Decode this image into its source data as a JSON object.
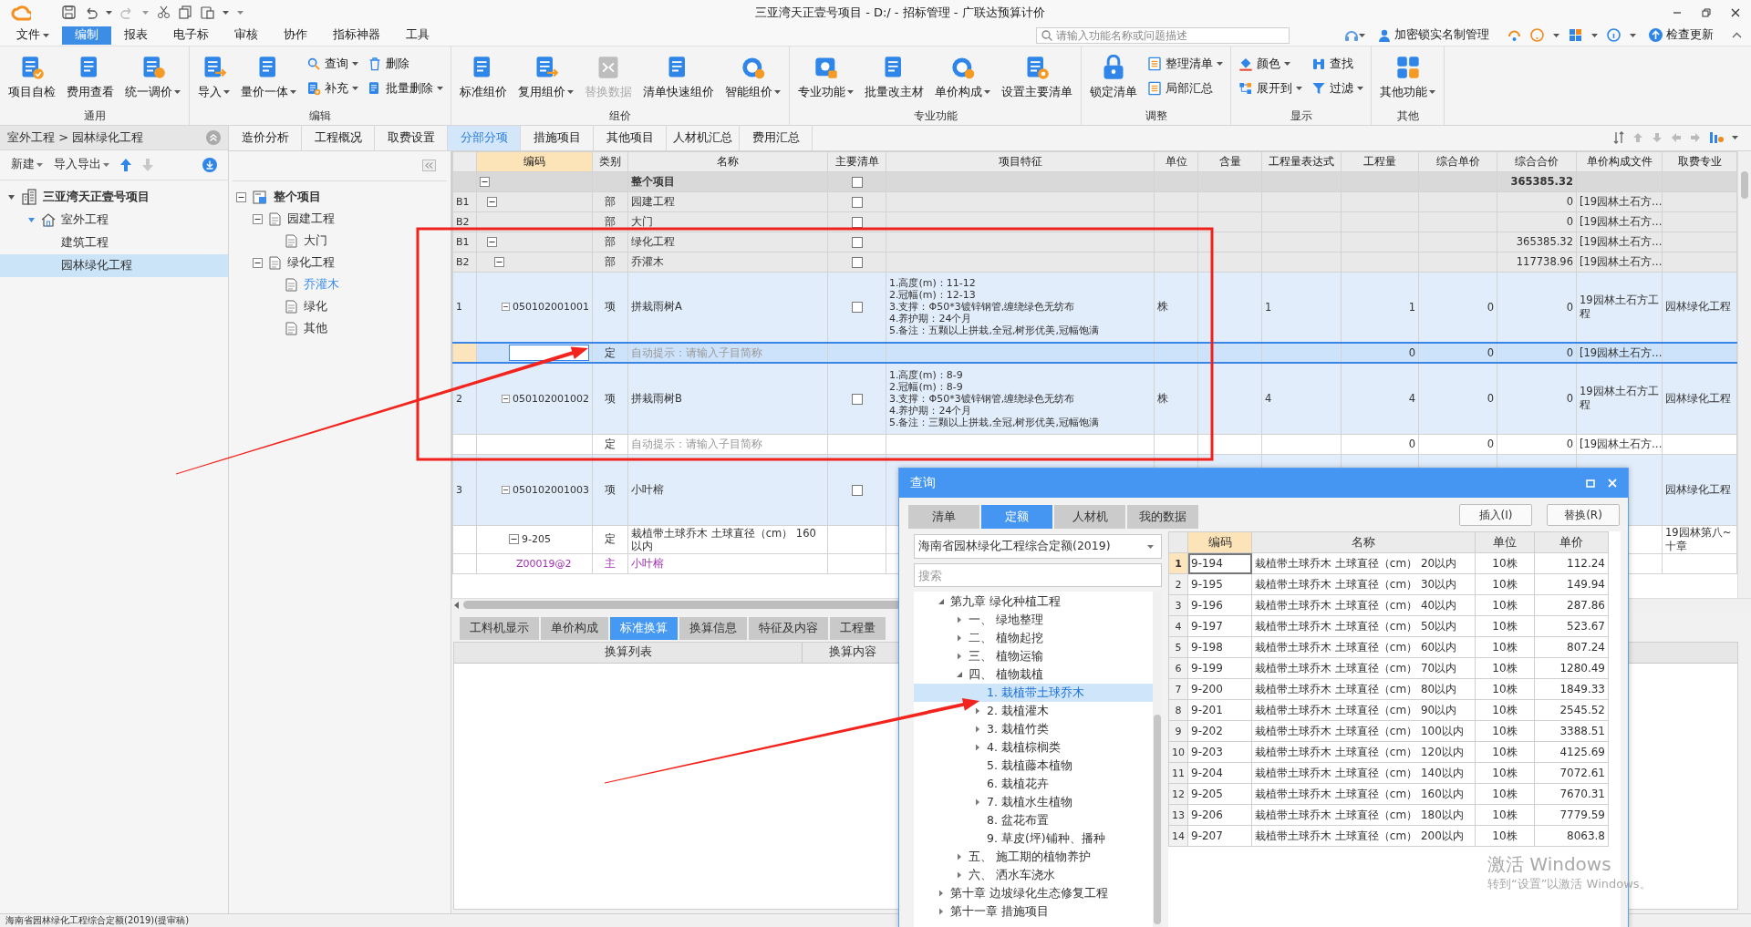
{
  "window": {
    "title": "三亚湾天正壹号项目 - D:/ - 招标管理 - 广联达预算计价"
  },
  "menu": [
    {
      "label": "文件",
      "dropdown": true,
      "selected": false
    },
    {
      "label": "编制",
      "dropdown": false,
      "selected": true
    },
    {
      "label": "报表",
      "dropdown": false,
      "selected": false
    },
    {
      "label": "电子标",
      "dropdown": false,
      "selected": false
    },
    {
      "label": "审核",
      "dropdown": false,
      "selected": false
    },
    {
      "label": "协作",
      "dropdown": false,
      "selected": false
    },
    {
      "label": "指标神器",
      "dropdown": false,
      "selected": false
    },
    {
      "label": "工具",
      "dropdown": false,
      "selected": false
    }
  ],
  "search": {
    "placeholder": "请输入功能名称或问题描述"
  },
  "account_links": [
    {
      "label": "加密锁实名制管理"
    },
    {
      "label": "检查更新"
    }
  ],
  "ribbon": [
    {
      "title": "通用",
      "items": [
        {
          "label": "项目自检",
          "kind": "large",
          "dropdown": false,
          "disabled": false
        },
        {
          "label": "费用查看",
          "kind": "large",
          "dropdown": false,
          "disabled": false
        },
        {
          "label": "统一调价",
          "kind": "large",
          "dropdown": true,
          "disabled": false
        }
      ]
    },
    {
      "title": "编辑",
      "items": [
        {
          "label": "导入",
          "kind": "large",
          "dropdown": true,
          "disabled": false
        },
        {
          "label": "量价一体",
          "kind": "large",
          "dropdown": true,
          "disabled": false
        },
        {
          "label": "查询",
          "kind": "small",
          "dropdown": true,
          "disabled": false
        },
        {
          "label": "补充",
          "kind": "small",
          "dropdown": true,
          "disabled": false
        },
        {
          "label": "删除",
          "kind": "small",
          "dropdown": false,
          "disabled": false
        },
        {
          "label": "批量删除",
          "kind": "small",
          "dropdown": true,
          "disabled": false
        }
      ]
    },
    {
      "title": "组价",
      "items": [
        {
          "label": "标准组价",
          "kind": "large",
          "dropdown": false,
          "disabled": false
        },
        {
          "label": "复用组价",
          "kind": "large",
          "dropdown": true,
          "disabled": false
        },
        {
          "label": "替换数据",
          "kind": "large",
          "dropdown": false,
          "disabled": true
        },
        {
          "label": "清单快速组价",
          "kind": "large",
          "dropdown": false,
          "disabled": false
        },
        {
          "label": "智能组价",
          "kind": "large",
          "dropdown": true,
          "disabled": false
        }
      ]
    },
    {
      "title": "专业功能",
      "items": [
        {
          "label": "专业功能",
          "kind": "large",
          "dropdown": true,
          "disabled": false
        },
        {
          "label": "批量改主材",
          "kind": "large",
          "dropdown": false,
          "disabled": false
        },
        {
          "label": "单价构成",
          "kind": "large",
          "dropdown": true,
          "disabled": false
        },
        {
          "label": "设置主要清单",
          "kind": "large",
          "dropdown": false,
          "disabled": false
        }
      ]
    },
    {
      "title": "调整",
      "items": [
        {
          "label": "锁定清单",
          "kind": "large",
          "dropdown": false,
          "disabled": false
        },
        {
          "label": "整理清单",
          "kind": "small",
          "dropdown": true,
          "disabled": false
        },
        {
          "label": "局部汇总",
          "kind": "small",
          "dropdown": false,
          "disabled": false
        }
      ]
    },
    {
      "title": "显示",
      "items": [
        {
          "label": "颜色",
          "kind": "small",
          "dropdown": true,
          "disabled": false
        },
        {
          "label": "展开到",
          "kind": "small",
          "dropdown": true,
          "disabled": false
        },
        {
          "label": "查找",
          "kind": "small",
          "dropdown": false,
          "disabled": false
        },
        {
          "label": "过滤",
          "kind": "small",
          "dropdown": true,
          "disabled": false
        }
      ]
    },
    {
      "title": "其他",
      "items": [
        {
          "label": "其他功能",
          "kind": "large",
          "dropdown": true,
          "disabled": false
        }
      ]
    }
  ],
  "nav_panel": {
    "breadcrumb": "室外工程 > 园林绿化工程",
    "actions": [
      {
        "label": "新建"
      },
      {
        "label": "导入导出"
      }
    ],
    "tree": [
      {
        "label": "三亚湾天正壹号项目",
        "selected": false,
        "expanded": true,
        "children": [
          {
            "label": "室外工程",
            "selected": false,
            "expanded": true,
            "children": [
              {
                "label": "建筑工程",
                "selected": false
              },
              {
                "label": "园林绿化工程",
                "selected": true
              }
            ]
          }
        ]
      }
    ]
  },
  "view_tabs": [
    {
      "label": "造价分析",
      "selected": false
    },
    {
      "label": "工程概况",
      "selected": false
    },
    {
      "label": "取费设置",
      "selected": false
    },
    {
      "label": "分部分项",
      "selected": true
    },
    {
      "label": "措施项目",
      "selected": false
    },
    {
      "label": "其他项目",
      "selected": false
    },
    {
      "label": "人材机汇总",
      "selected": false
    },
    {
      "label": "费用汇总",
      "selected": false
    }
  ],
  "section_tree": [
    {
      "label": "整个项目",
      "selected": false,
      "expanded": true,
      "children": [
        {
          "label": "园建工程",
          "selected": false,
          "expanded": true,
          "children": [
            {
              "label": "大门",
              "selected": false
            }
          ]
        },
        {
          "label": "绿化工程",
          "selected": false,
          "expanded": true,
          "children": [
            {
              "label": "乔灌木",
              "selected": true
            },
            {
              "label": "绿化",
              "selected": false
            },
            {
              "label": "其他",
              "selected": false
            }
          ]
        }
      ]
    }
  ],
  "bill_table": {
    "columns": [
      {
        "label": "编码",
        "selected": true
      },
      {
        "label": "类别",
        "selected": false
      },
      {
        "label": "名称",
        "selected": false
      },
      {
        "label": "主要清单",
        "selected": false
      },
      {
        "label": "项目特征",
        "selected": false
      },
      {
        "label": "单位",
        "selected": false
      },
      {
        "label": "含量",
        "selected": false
      },
      {
        "label": "工程量表达式",
        "selected": false
      },
      {
        "label": "工程量",
        "selected": false
      },
      {
        "label": "综合单价",
        "selected": false
      },
      {
        "label": "综合合价",
        "selected": false
      },
      {
        "label": "单价构成文件",
        "selected": false
      },
      {
        "label": "取费专业",
        "selected": false
      }
    ],
    "rows": [
      {
        "kind": "root",
        "selected": false,
        "expanded": true,
        "name": "整个项目",
        "checked": false,
        "total": "365385.32",
        "children": [
          {
            "kind": "section",
            "num": "B1",
            "selected": false,
            "expanded": true,
            "type": "部",
            "name": "园建工程",
            "checked": false,
            "total": "0",
            "price_file": "[19园林土石方…",
            "children": [
              {
                "kind": "section",
                "num": "B2",
                "selected": false,
                "type": "部",
                "name": "大门",
                "checked": false,
                "total": "0",
                "price_file": "[19园林土石方…"
              }
            ]
          },
          {
            "kind": "section",
            "num": "B1",
            "selected": false,
            "expanded": true,
            "type": "部",
            "name": "绿化工程",
            "checked": false,
            "total": "365385.32",
            "price_file": "[19园林土石方…",
            "children": [
              {
                "kind": "section",
                "num": "B2",
                "selected": false,
                "expanded": true,
                "type": "部",
                "name": "乔灌木",
                "checked": false,
                "total": "117738.96",
                "price_file": "[19园林土石方…",
                "children": [
                  {
                    "kind": "item",
                    "num": "1",
                    "selected": false,
                    "expanded": true,
                    "code": "050102001001",
                    "type": "项",
                    "name": "拼栽雨树A",
                    "checked": false,
                    "features": [
                      "1.高度(m)：11-12",
                      "2.冠幅(m)：12-13",
                      "3.支撑：Φ50*3镀锌钢管,缠绕绿色无纺布",
                      "4.养护期：24个月",
                      "5.备注：五颗以上拼栽,全冠,树形优美,冠幅饱满"
                    ],
                    "unit": "株",
                    "quantity_expr": "1",
                    "quantity": "1",
                    "unit_price": "0",
                    "total": "0",
                    "price_file": "19园林土石方工程",
                    "fee_type": "园林绿化工程",
                    "children": [
                      {
                        "kind": "quota",
                        "selected": true,
                        "type": "定",
                        "name_hint": "自动提示：请输入子目简称",
                        "quantity": "0",
                        "unit_price": "0",
                        "total": "0",
                        "price_file": "[19园林土石方…"
                      }
                    ]
                  },
                  {
                    "kind": "item",
                    "num": "2",
                    "selected": false,
                    "expanded": true,
                    "code": "050102001002",
                    "type": "项",
                    "name": "拼栽雨树B",
                    "checked": false,
                    "features": [
                      "1.高度(m)：8-9",
                      "2.冠幅(m)：8-9",
                      "3.支撑：Φ50*3镀锌钢管,缠绕绿色无纺布",
                      "4.养护期：24个月",
                      "5.备注：三颗以上拼栽,全冠,树形优美,冠幅饱满"
                    ],
                    "unit": "株",
                    "quantity_expr": "4",
                    "quantity": "4",
                    "unit_price": "0",
                    "total": "0",
                    "price_file": "19园林土石方工程",
                    "fee_type": "园林绿化工程",
                    "children": [
                      {
                        "kind": "quota",
                        "selected": false,
                        "type": "定",
                        "name_hint": "自动提示：请输入子目简称",
                        "quantity": "0",
                        "unit_price": "0",
                        "total": "0",
                        "price_file": "[19园林土石方…"
                      }
                    ]
                  },
                  {
                    "kind": "item",
                    "num": "3",
                    "selected": false,
                    "expanded": true,
                    "code": "050102001003",
                    "type": "项",
                    "name": "小叶榕",
                    "checked": false,
                    "fee_type": "园林绿化工程",
                    "children": [
                      {
                        "kind": "quota",
                        "selected": false,
                        "expanded": true,
                        "code": "9-205",
                        "type": "定",
                        "name": "栽植带土球乔木 土球直径（cm） 160以内",
                        "fee_type": "19园林第八~十章",
                        "children": [
                          {
                            "kind": "material",
                            "selected": false,
                            "code": "Z00019@2",
                            "type": "主",
                            "name": "小叶榕"
                          }
                        ]
                      }
                    ]
                  }
                ]
              }
            ]
          }
        ]
      }
    ]
  },
  "detail_tabs": [
    {
      "label": "工料机显示",
      "selected": false
    },
    {
      "label": "单价构成",
      "selected": false
    },
    {
      "label": "标准换算",
      "selected": true
    },
    {
      "label": "换算信息",
      "selected": false
    },
    {
      "label": "特征及内容",
      "selected": false
    },
    {
      "label": "工程量",
      "selected": false
    }
  ],
  "detail_columns": [
    "换算列表",
    "换算内容"
  ],
  "query_dialog": {
    "title": "查询",
    "tabs": [
      {
        "label": "清单",
        "selected": false
      },
      {
        "label": "定额",
        "selected": true
      },
      {
        "label": "人材机",
        "selected": false
      },
      {
        "label": "我的数据",
        "selected": false
      }
    ],
    "buttons": [
      {
        "label": "插入(I)"
      },
      {
        "label": "替换(R)"
      }
    ],
    "library": "海南省园林绿化工程综合定额(2019)",
    "search_placeholder": "搜索",
    "tree": [
      {
        "label": "第九章 绿化种植工程",
        "selected": false,
        "expanded": true,
        "children": [
          {
            "label": "一、 绿地整理",
            "selected": false,
            "expanded": false
          },
          {
            "label": "二、 植物起挖",
            "selected": false,
            "expanded": false
          },
          {
            "label": "三、 植物运输",
            "selected": false,
            "expanded": false
          },
          {
            "label": "四、 植物栽植",
            "selected": false,
            "expanded": true,
            "children": [
              {
                "label": "1. 栽植带土球乔木",
                "selected": true
              },
              {
                "label": "2. 栽植灌木",
                "selected": false,
                "expanded": false
              },
              {
                "label": "3. 栽植竹类",
                "selected": false,
                "expanded": false
              },
              {
                "label": "4. 栽植棕榈类",
                "selected": false,
                "expanded": false
              },
              {
                "label": "5. 栽植藤本植物",
                "selected": false
              },
              {
                "label": "6. 栽植花卉",
                "selected": false
              },
              {
                "label": "7. 栽植水生植物",
                "selected": false,
                "expanded": false
              },
              {
                "label": "8. 盆花布置",
                "selected": false
              },
              {
                "label": "9. 草皮(坪)铺种、播种",
                "selected": false
              }
            ]
          },
          {
            "label": "五、 施工期的植物养护",
            "selected": false,
            "expanded": false
          },
          {
            "label": "六、 洒水车浇水",
            "selected": false,
            "expanded": false
          }
        ]
      },
      {
        "label": "第十章 边坡绿化生态修复工程",
        "selected": false,
        "expanded": false
      },
      {
        "label": "第十一章 措施项目",
        "selected": false,
        "expanded": false
      }
    ],
    "columns": [
      {
        "label": "编码",
        "selected": true
      },
      {
        "label": "名称",
        "selected": false
      },
      {
        "label": "单位",
        "selected": false
      },
      {
        "label": "单价",
        "selected": false
      }
    ],
    "rows": [
      {
        "num": "1",
        "code": "9-194",
        "name": "栽植带土球乔木 土球直径（cm） 20以内",
        "unit": "10株",
        "price": "112.24",
        "selected": true
      },
      {
        "num": "2",
        "code": "9-195",
        "name": "栽植带土球乔木 土球直径（cm） 30以内",
        "unit": "10株",
        "price": "149.94",
        "selected": false
      },
      {
        "num": "3",
        "code": "9-196",
        "name": "栽植带土球乔木 土球直径（cm） 40以内",
        "unit": "10株",
        "price": "287.86",
        "selected": false
      },
      {
        "num": "4",
        "code": "9-197",
        "name": "栽植带土球乔木 土球直径（cm） 50以内",
        "unit": "10株",
        "price": "523.67",
        "selected": false
      },
      {
        "num": "5",
        "code": "9-198",
        "name": "栽植带土球乔木 土球直径（cm） 60以内",
        "unit": "10株",
        "price": "807.24",
        "selected": false
      },
      {
        "num": "6",
        "code": "9-199",
        "name": "栽植带土球乔木 土球直径（cm） 70以内",
        "unit": "10株",
        "price": "1280.49",
        "selected": false
      },
      {
        "num": "7",
        "code": "9-200",
        "name": "栽植带土球乔木 土球直径（cm） 80以内",
        "unit": "10株",
        "price": "1849.33",
        "selected": false
      },
      {
        "num": "8",
        "code": "9-201",
        "name": "栽植带土球乔木 土球直径（cm） 90以内",
        "unit": "10株",
        "price": "2545.52",
        "selected": false
      },
      {
        "num": "9",
        "code": "9-202",
        "name": "栽植带土球乔木 土球直径（cm） 100以内",
        "unit": "10株",
        "price": "3388.51",
        "selected": false
      },
      {
        "num": "10",
        "code": "9-203",
        "name": "栽植带土球乔木 土球直径（cm） 120以内",
        "unit": "10株",
        "price": "4125.69",
        "selected": false
      },
      {
        "num": "11",
        "code": "9-204",
        "name": "栽植带土球乔木 土球直径（cm） 140以内",
        "unit": "10株",
        "price": "7072.61",
        "selected": false
      },
      {
        "num": "12",
        "code": "9-205",
        "name": "栽植带土球乔木 土球直径（cm） 160以内",
        "unit": "10株",
        "price": "7670.31",
        "selected": false
      },
      {
        "num": "13",
        "code": "9-206",
        "name": "栽植带土球乔木 土球直径（cm） 180以内",
        "unit": "10株",
        "price": "7779.59",
        "selected": false
      },
      {
        "num": "14",
        "code": "9-207",
        "name": "栽植带土球乔木 土球直径（cm） 200以内",
        "unit": "10株",
        "price": "8063.8",
        "selected": false
      }
    ]
  },
  "system_notice": {
    "title": "激活 Windows",
    "message": "转到“设置”以激活 Windows。"
  },
  "status_bar": {
    "text": "海南省园林绿化工程综合定额(2019)(提审稿)"
  },
  "annotations": [
    {
      "kind": "box"
    },
    {
      "kind": "arrow"
    },
    {
      "kind": "arrow"
    }
  ]
}
